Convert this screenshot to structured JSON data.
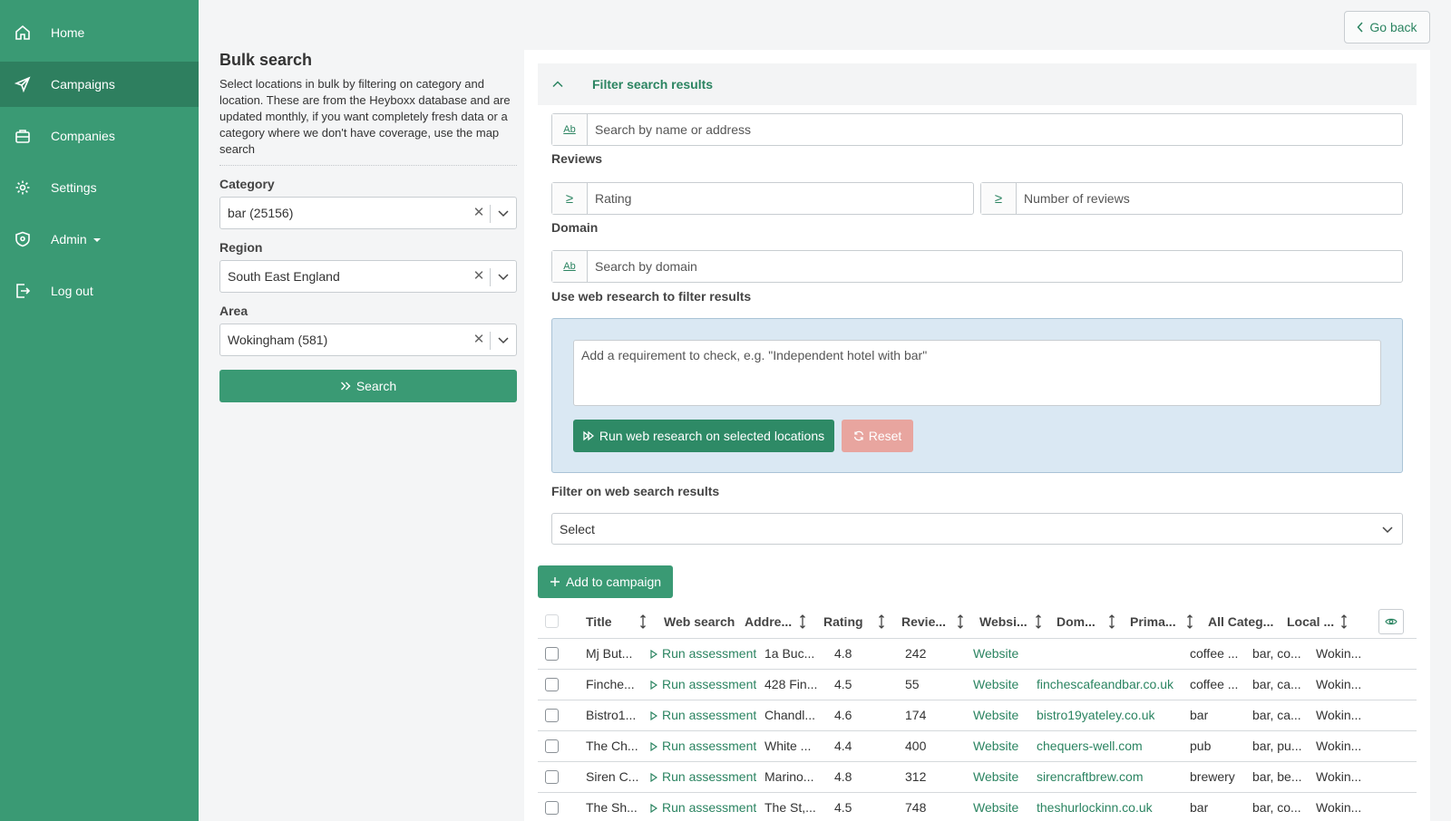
{
  "sidebar": {
    "items": [
      {
        "label": "Home",
        "icon": "home-icon"
      },
      {
        "label": "Campaigns",
        "icon": "send-icon",
        "active": true
      },
      {
        "label": "Companies",
        "icon": "briefcase-icon"
      },
      {
        "label": "Settings",
        "icon": "gear-icon"
      },
      {
        "label": "Admin",
        "icon": "shield-icon"
      },
      {
        "label": "Log out",
        "icon": "logout-icon"
      }
    ]
  },
  "header": {
    "go_back_label": "Go back"
  },
  "bulk": {
    "title": "Bulk search",
    "description": "Select locations in bulk by filtering on category and location. These are from the Heyboxx database and are updated monthly, if you want completely fresh data or a category where we don't have coverage, use the map search",
    "category_label": "Category",
    "category_value": "bar (25156)",
    "region_label": "Region",
    "region_value": "South East England",
    "area_label": "Area",
    "area_value": "Wokingham (581)",
    "search_label": "Search"
  },
  "filter": {
    "header_title": "Filter search results",
    "name_addon": "Ab",
    "name_placeholder": "Search by name or address",
    "reviews_label": "Reviews",
    "ge_symbol": "≥",
    "rating_placeholder": "Rating",
    "num_reviews_placeholder": "Number of reviews",
    "domain_label": "Domain",
    "domain_addon": "Ab",
    "domain_placeholder": "Search by domain",
    "web_research_label": "Use web research to filter results",
    "requirement_placeholder": "Add a requirement to check, e.g. \"Independent hotel with bar\"",
    "run_label": "Run web research on selected locations",
    "reset_label": "Reset",
    "ws_filter_label": "Filter on web search results",
    "ws_select_value": "Select",
    "add_campaign_label": "Add to campaign"
  },
  "table": {
    "columns": [
      "Title",
      "Web search",
      "Addre...",
      "Rating",
      "Revie...",
      "Websi...",
      "Dom...",
      "Prima...",
      "All Categ...",
      "Local ..."
    ],
    "rows": [
      {
        "title": "Mj But...",
        "web_search": "Run assessment",
        "address": "1a Buc...",
        "rating": "4.8",
        "reviews": "242",
        "website": "Website",
        "domain": "",
        "primary": "coffee ...",
        "all_categories": "bar, co...",
        "local": "Wokin..."
      },
      {
        "title": "Finche...",
        "web_search": "Run assessment",
        "address": "428 Fin...",
        "rating": "4.5",
        "reviews": "55",
        "website": "Website",
        "domain": "finchescafeandbar.co.uk",
        "primary": "coffee ...",
        "all_categories": "bar, ca...",
        "local": "Wokin..."
      },
      {
        "title": "Bistro1...",
        "web_search": "Run assessment",
        "address": "Chandl...",
        "rating": "4.6",
        "reviews": "174",
        "website": "Website",
        "domain": "bistro19yateley.co.uk",
        "primary": "bar",
        "all_categories": "bar, ca...",
        "local": "Wokin..."
      },
      {
        "title": "The Ch...",
        "web_search": "Run assessment",
        "address": "White ...",
        "rating": "4.4",
        "reviews": "400",
        "website": "Website",
        "domain": "chequers-well.com",
        "primary": "pub",
        "all_categories": "bar, pu...",
        "local": "Wokin..."
      },
      {
        "title": "Siren C...",
        "web_search": "Run assessment",
        "address": "Marino...",
        "rating": "4.8",
        "reviews": "312",
        "website": "Website",
        "domain": "sirencraftbrew.com",
        "primary": "brewery",
        "all_categories": "bar, be...",
        "local": "Wokin..."
      },
      {
        "title": "The Sh...",
        "web_search": "Run assessment",
        "address": "The St,...",
        "rating": "4.5",
        "reviews": "748",
        "website": "Website",
        "domain": "theshurlockinn.co.uk",
        "primary": "bar",
        "all_categories": "bar, co...",
        "local": "Wokin..."
      }
    ]
  },
  "colors": {
    "sidebar": "#3a9a74",
    "sidebar_active": "#2e7f5f",
    "accent": "#2b8461",
    "web_box": "#dae8f3",
    "reset": "#e8a59f"
  }
}
